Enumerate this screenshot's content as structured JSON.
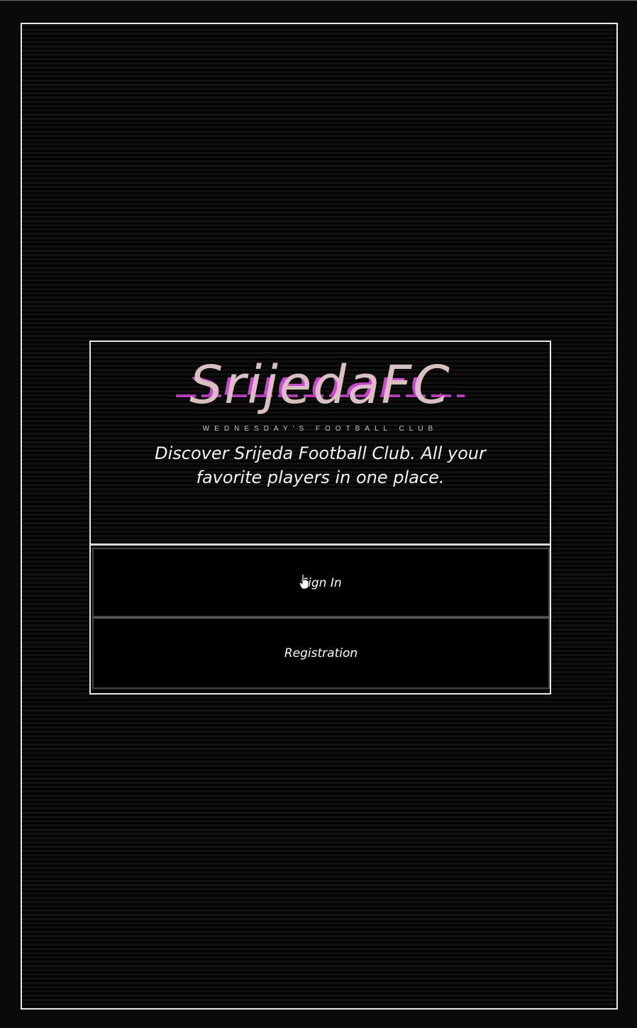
{
  "brand": {
    "logo_text": "SrijedaFC",
    "tagline": "Wednesday's Football Club"
  },
  "hero": {
    "headline": "Discover Srijeda Football Club. All your favorite players in one place."
  },
  "actions": {
    "sign_in_label": "Sign In",
    "registration_label": "Registration"
  },
  "colors": {
    "background": "#050505",
    "frame_border": "#e8e8e8",
    "logo_primary": "#d8c0c0",
    "logo_accent": "#cf44d2",
    "text": "#f2f2f2"
  },
  "icons": {
    "pointer": "hand-pointer-icon"
  }
}
